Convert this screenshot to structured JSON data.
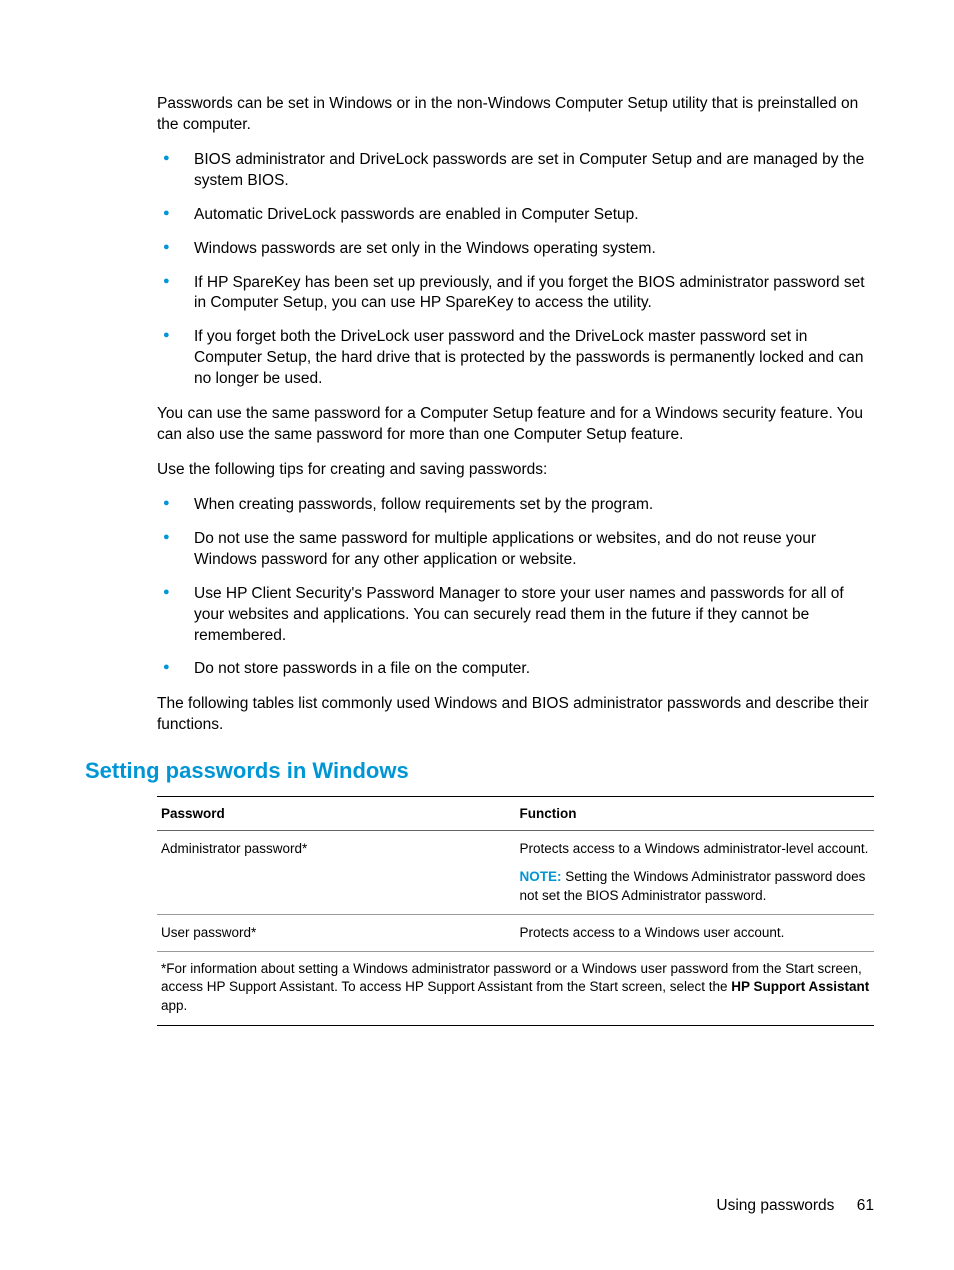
{
  "intro": "Passwords can be set in Windows or in the non-Windows Computer Setup utility that is preinstalled on the computer.",
  "list1": {
    "i0": "BIOS administrator and DriveLock passwords are set in Computer Setup and are managed by the system BIOS.",
    "i1": "Automatic DriveLock passwords are enabled in Computer Setup.",
    "i2": "Windows passwords are set only in the Windows operating system.",
    "i3": "If HP SpareKey has been set up previously, and if you forget the BIOS administrator password set in Computer Setup, you can use HP SpareKey to access the utility.",
    "i4": "If you forget both the DriveLock user password and the DriveLock master password set in Computer Setup, the hard drive that is protected by the passwords is permanently locked and can no longer be used."
  },
  "mid1": "You can use the same password for a Computer Setup feature and for a Windows security feature. You can also use the same password for more than one Computer Setup feature.",
  "mid2": "Use the following tips for creating and saving passwords:",
  "list2": {
    "i0": "When creating passwords, follow requirements set by the program.",
    "i1": "Do not use the same password for multiple applications or websites, and do not reuse your Windows password for any other application or website.",
    "i2": "Use HP Client Security's Password Manager to store your user names and passwords for all of your websites and applications. You can securely read them in the future if they cannot be remembered.",
    "i3": "Do not store passwords in a file on the computer."
  },
  "mid3": "The following tables list commonly used Windows and BIOS administrator passwords and describe their functions.",
  "heading": "Setting passwords in Windows",
  "table": {
    "h1": "Password",
    "h2": "Function",
    "r1c1": "Administrator password*",
    "r1c2a": "Protects access to a Windows administrator-level account.",
    "noteLabel": "NOTE:",
    "r1c2b": "Setting the Windows Administrator password does not set the BIOS Administrator password.",
    "r2c1": "User password*",
    "r2c2": "Protects access to a Windows user account."
  },
  "footnote": {
    "a": "*For information about setting a Windows administrator password or a Windows user password from the Start screen, access HP Support Assistant. To access HP Support Assistant from the Start screen, select the ",
    "b": "HP Support Assistant",
    "c": " app."
  },
  "footer": {
    "label": "Using passwords",
    "page": "61"
  }
}
